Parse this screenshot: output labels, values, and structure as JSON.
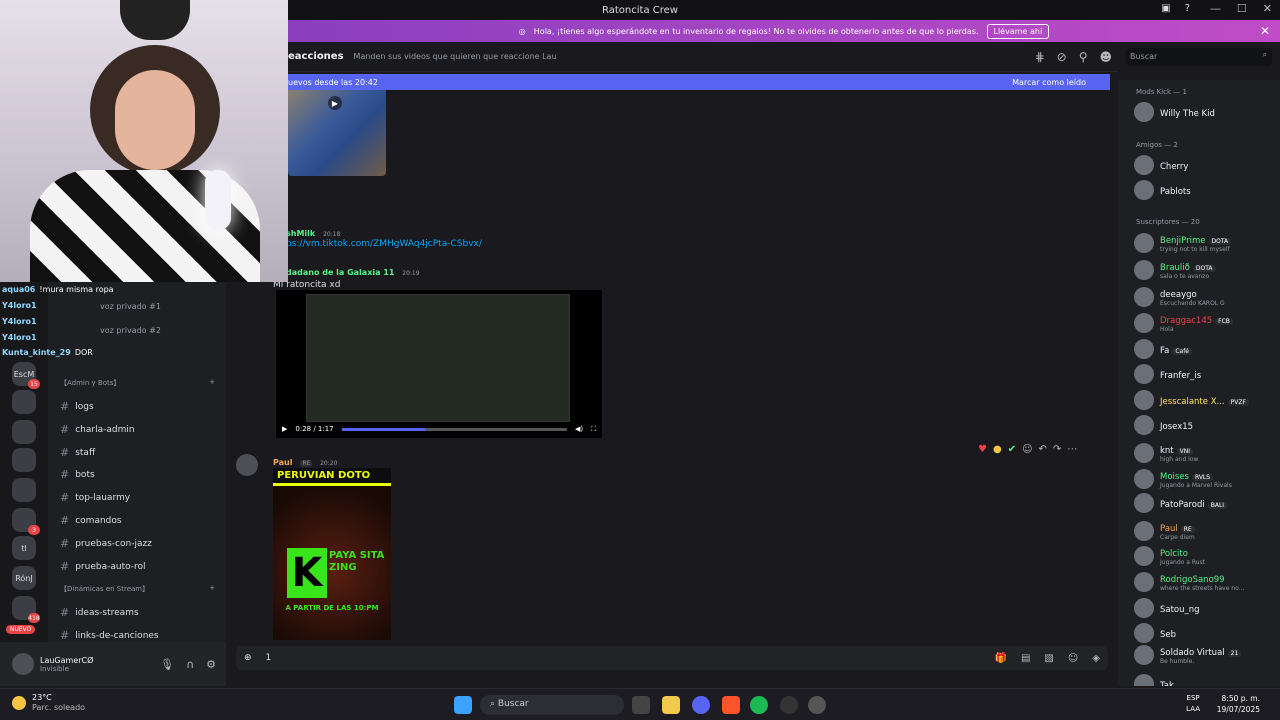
{
  "window": {
    "title": "Ratoncita Crew",
    "controls": [
      "—",
      "☐",
      "✕"
    ]
  },
  "notice": {
    "text": "Hola, ¡tienes algo esperándote en tu inventario de regalos! No te olvides de obtenerlo antes de que lo pierdas.",
    "button": "Llévame ahí",
    "close": "✕"
  },
  "channel": {
    "name": "eacciones",
    "topic": "Manden sus videos que quieren que reaccione Lau"
  },
  "search": {
    "placeholder": "Buscar"
  },
  "newbar": {
    "text": "uevos desde las 20:42",
    "action": "Marcar como leído"
  },
  "chat_overlay": [
    {
      "user": "aqua06",
      "text": "!mura misma ropa"
    },
    {
      "user": "Y4loro1",
      "text": ""
    },
    {
      "user": "Y4loro1",
      "text": ""
    },
    {
      "user": "Y4loro1",
      "text": ""
    },
    {
      "user": "Kunta_kinte_29",
      "text": "DOR"
    }
  ],
  "voice": [
    "voz privado #1",
    "voz privado #2"
  ],
  "categories": {
    "admin": "【Admin y Bots】",
    "dinamicas": "【Dinámicas en Stream】"
  },
  "channels": [
    "logs",
    "charla-admin",
    "staff",
    "bots",
    "top-lauarmy",
    "comandos",
    "pruebas-con-jazz",
    "prueba-auto-rol",
    "ideas-streams",
    "links-de-canciones"
  ],
  "servers": [
    {
      "label": "EscM",
      "badge": "15"
    },
    {
      "label": "",
      "badge": ""
    },
    {
      "label": "",
      "badge": ""
    },
    {
      "label": "",
      "badge": ""
    },
    {
      "label": "",
      "badge": ""
    },
    {
      "label": "",
      "badge": "3"
    },
    {
      "label": "tl",
      "badge": ""
    },
    {
      "label": "RónJ",
      "badge": ""
    },
    {
      "label": "",
      "badge": "418"
    }
  ],
  "new_label": "NUEVO",
  "user": {
    "name": "LauGamerCØ",
    "status": "Invisible"
  },
  "messages": {
    "m1": {
      "name": "shMilk",
      "time": "20:18",
      "link": "ps://vm.tiktok.com/ZMHgWAq4jcPta-CSbvx/"
    },
    "m2": {
      "name": "dadano de la Galaxia 11",
      "time": "20:19",
      "text": "Mi ratoncita xd",
      "video_time": "0:28 / 1:17",
      "progress": 0.37
    },
    "m3": {
      "name": "Paul",
      "tag": "RE",
      "time": "20:20"
    }
  },
  "poster": {
    "top": "PERUVIAN DOTO",
    "k": "K",
    "side": "PAYA SITA ZING",
    "foot": "A PARTIR DE LAS 10:PM"
  },
  "composer": {
    "text": "1"
  },
  "members": {
    "cats": [
      "Mods Kick — 1",
      "Amigos — 2",
      "Suscriptores — 20"
    ],
    "list": [
      {
        "name": "Willy The Kid",
        "sub": "",
        "tag": "",
        "color": "#f2f3f5"
      },
      {
        "name": "Cherry",
        "sub": "",
        "tag": "",
        "color": "#f2f3f5"
      },
      {
        "name": "Pablots",
        "sub": "",
        "tag": "",
        "color": "#f2f3f5"
      },
      {
        "name": "BenjiPrime",
        "sub": "trying not to kill myself",
        "tag": "DOTA",
        "color": "#57f287"
      },
      {
        "name": "Braulið",
        "sub": "sala o te avanzo",
        "tag": "DOTA",
        "color": "#57f287"
      },
      {
        "name": "deeaygo",
        "sub": "Escuchando KAROL G",
        "tag": "",
        "color": "#f2f3f5"
      },
      {
        "name": "Draggac145",
        "sub": "Hola",
        "tag": "FCB",
        "color": "#ed4245"
      },
      {
        "name": "Fa",
        "sub": "",
        "tag": "Café",
        "color": "#f2f3f5"
      },
      {
        "name": "Franfer_is",
        "sub": "",
        "tag": "",
        "color": "#f2f3f5"
      },
      {
        "name": "Jesscalante X...",
        "sub": "",
        "tag": "PVZF",
        "color": "#fee75c"
      },
      {
        "name": "Josex15",
        "sub": "",
        "tag": "",
        "color": "#f2f3f5"
      },
      {
        "name": "knt",
        "sub": "high and low",
        "tag": "VNI",
        "color": "#f2f3f5"
      },
      {
        "name": "Moises",
        "sub": "Jugando a Marvel Rivals",
        "tag": "RVLS",
        "color": "#57f287"
      },
      {
        "name": "PatoParodi",
        "sub": "",
        "tag": "BALI",
        "color": "#f2f3f5"
      },
      {
        "name": "Paul",
        "sub": "Carpe diem",
        "tag": "RE",
        "color": "#f2a65a"
      },
      {
        "name": "Polcito",
        "sub": "Jugando a Rust",
        "tag": "",
        "color": "#57f287"
      },
      {
        "name": "RodrigoSano99",
        "sub": "where the streets have no...",
        "tag": "",
        "color": "#57f287"
      },
      {
        "name": "Satou_ng",
        "sub": "",
        "tag": "",
        "color": "#f2f3f5"
      },
      {
        "name": "Seb",
        "sub": "",
        "tag": "",
        "color": "#f2f3f5"
      },
      {
        "name": "Soldado Virtual",
        "sub": "Be humble.",
        "tag": "21",
        "color": "#f2f3f5"
      },
      {
        "name": "Tak.",
        "sub": "",
        "tag": "",
        "color": "#f2f3f5"
      }
    ]
  },
  "taskbar": {
    "temp": "23°C",
    "weather": "Parc. soleado",
    "search": "Buscar",
    "lang1": "ESP",
    "lang2": "LAA",
    "time": "8:50 p. m.",
    "date": "19/07/2025"
  }
}
